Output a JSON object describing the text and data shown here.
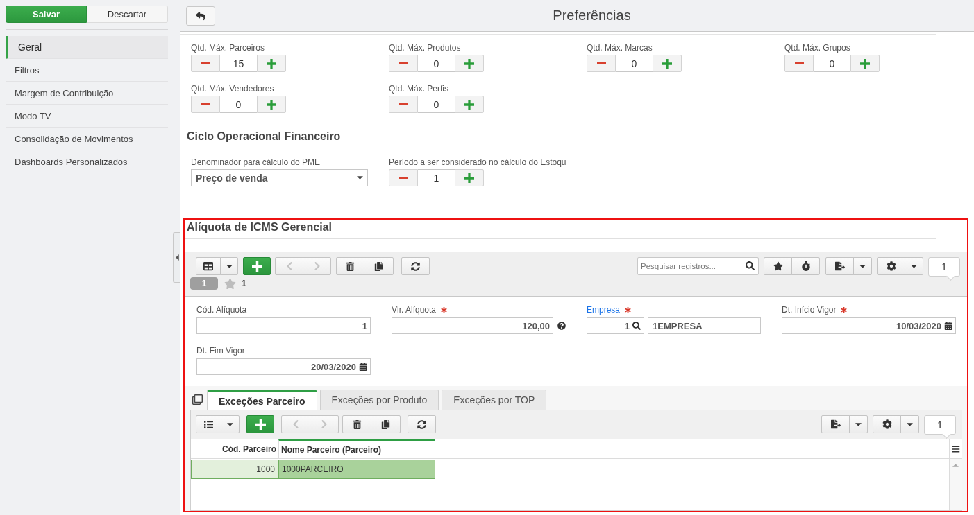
{
  "sidebar": {
    "actions": [
      {
        "label": "Salvar",
        "kind": "primary"
      },
      {
        "label": "Descartar",
        "kind": "secondary"
      }
    ],
    "items": [
      {
        "label": "Geral",
        "selected": true
      },
      {
        "label": "Filtros",
        "selected": false
      },
      {
        "label": "Margem de Contribuição",
        "selected": false
      },
      {
        "label": "Modo TV",
        "selected": false
      },
      {
        "label": "Consolidação de Movimentos",
        "selected": false
      },
      {
        "label": "Dashboards Personalizados",
        "selected": false
      }
    ]
  },
  "header": {
    "title": "Preferências"
  },
  "quantity_limits": [
    {
      "label": "Qtd. Máx. Parceiros",
      "value": "15"
    },
    {
      "label": "Qtd. Máx. Produtos",
      "value": "0"
    },
    {
      "label": "Qtd. Máx. Marcas",
      "value": "0"
    },
    {
      "label": "Qtd. Máx. Grupos",
      "value": "0"
    },
    {
      "label": "Qtd. Máx. Vendedores",
      "value": "0"
    },
    {
      "label": "Qtd. Máx. Perfis",
      "value": "0"
    }
  ],
  "financial_cycle": {
    "title": "Ciclo Operacional Financeiro",
    "fields": [
      {
        "kind": "select",
        "label": "Denominador para cálculo do PME",
        "value": "Preço de venda"
      },
      {
        "kind": "stepper",
        "label": "Período a ser considerado no cálculo do Estoqu",
        "value": "1"
      }
    ]
  },
  "icms": {
    "title": "Alíquota de ICMS Gerencial",
    "highlighted": true,
    "toolbar": {
      "search": {
        "placeholder": "Pesquisar registros..."
      },
      "record_count": "1"
    },
    "record_badge": "1",
    "starred_count": "1",
    "form": {
      "fields": [
        {
          "kind": "text",
          "label": "Cód. Alíquota",
          "required": false,
          "linked": false,
          "value": "1"
        },
        {
          "kind": "help",
          "label": "Vlr. Alíquota",
          "required": true,
          "linked": false,
          "value": "120,00"
        },
        {
          "kind": "lookup",
          "label": "Empresa",
          "required": true,
          "linked": true,
          "code": "1",
          "value": "1EMPRESA"
        },
        {
          "kind": "date",
          "label": "Dt. Início Vigor",
          "required": true,
          "linked": false,
          "value": "10/03/2020"
        },
        {
          "kind": "date",
          "label": "Dt. Fim Vigor",
          "required": false,
          "linked": false,
          "value": "20/03/2020"
        }
      ]
    },
    "detail": {
      "tabs": [
        {
          "label": "Exceções Parceiro",
          "selected": true
        },
        {
          "label": "Exceções por Produto",
          "selected": false
        },
        {
          "label": "Exceções por TOP",
          "selected": false
        }
      ],
      "record_count": "1",
      "table": {
        "columns": [
          {
            "label": "Cód. Parceiro",
            "kind": "number",
            "focused": false
          },
          {
            "label": "Nome Parceiro (Parceiro)",
            "kind": "text",
            "focused": true
          }
        ],
        "rows": [
          {
            "cells": [
              "1000",
              "1000PARCEIRO"
            ],
            "selected": true
          }
        ]
      }
    }
  }
}
